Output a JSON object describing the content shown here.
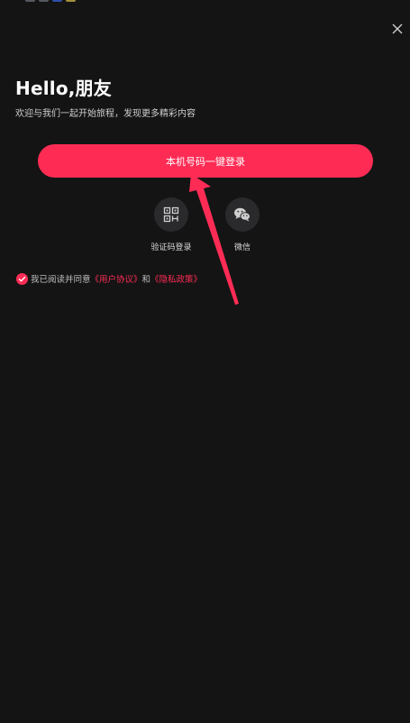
{
  "status_bar": {
    "icons": [
      "app-icon-gray",
      "app-icon-gray",
      "app-icon-blue",
      "app-icon-yellow"
    ]
  },
  "header": {
    "close_icon": "close-icon"
  },
  "welcome": {
    "title": "Hello,朋友",
    "subtitle": "欢迎与我们一起开始旅程，发现更多精彩内容"
  },
  "login": {
    "one_click_label": "本机号码一键登录",
    "options": [
      {
        "label": "验证码登录",
        "icon": "qr-code-icon"
      },
      {
        "label": "微信",
        "icon": "wechat-icon"
      }
    ]
  },
  "agreement": {
    "prefix": "我已阅读并同意",
    "user_agreement": "《用户协议》",
    "conjunction": "和",
    "privacy_policy": "《隐私政策》",
    "checked": true
  },
  "annotation": {
    "type": "arrow",
    "color": "#fe2c55",
    "target": "one-click-login-button"
  },
  "colors": {
    "background": "#141414",
    "accent": "#fe2c55",
    "option_circle": "#2a2a2c"
  }
}
